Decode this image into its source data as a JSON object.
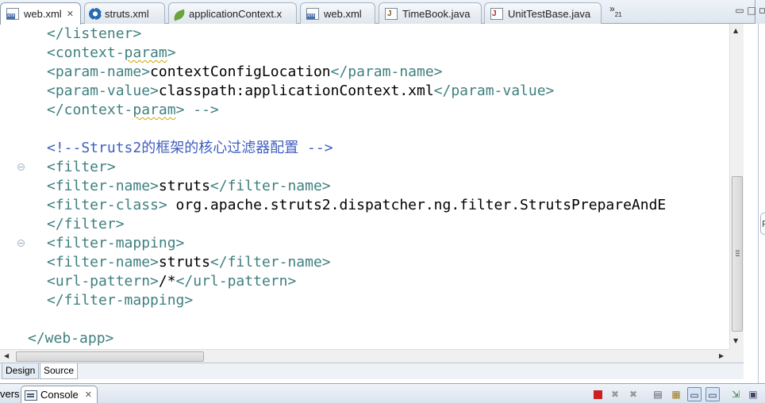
{
  "editor_tabs": [
    {
      "label": "web.xml",
      "icon": "xml-file-icon",
      "active": true,
      "closable": true
    },
    {
      "label": "struts.xml",
      "icon": "gear-icon",
      "active": false
    },
    {
      "label": "applicationContext.x",
      "icon": "spring-leaf-icon",
      "active": false
    },
    {
      "label": "web.xml",
      "icon": "xml-file-icon",
      "active": false
    },
    {
      "label": "TimeBook.java",
      "icon": "java-file-icon",
      "active": false
    },
    {
      "label": "UnitTestBase.java",
      "icon": "junit-file-icon",
      "active": false
    }
  ],
  "tab_overflow": {
    "chevron": "»",
    "count": "21"
  },
  "code_lines": [
    {
      "indent": 1,
      "parts": [
        {
          "t": "</listener>",
          "c": "tag"
        }
      ]
    },
    {
      "indent": 1,
      "parts": [
        {
          "t": "<context-",
          "c": "tag"
        },
        {
          "t": "param",
          "c": "tag",
          "w": true
        },
        {
          "t": ">",
          "c": "tag"
        }
      ]
    },
    {
      "indent": 1,
      "parts": [
        {
          "t": "<param-name>",
          "c": "tag"
        },
        {
          "t": "contextConfigLocation",
          "c": "txt"
        },
        {
          "t": "</param-name>",
          "c": "tag"
        }
      ]
    },
    {
      "indent": 1,
      "parts": [
        {
          "t": "<param-value>",
          "c": "tag"
        },
        {
          "t": "classpath:applicationContext.xml",
          "c": "txt"
        },
        {
          "t": "</param-value>",
          "c": "tag"
        }
      ]
    },
    {
      "indent": 1,
      "parts": [
        {
          "t": "</context-",
          "c": "tag"
        },
        {
          "t": "param",
          "c": "tag",
          "w": true
        },
        {
          "t": "> -->",
          "c": "tag"
        }
      ]
    },
    {
      "indent": 1,
      "parts": []
    },
    {
      "indent": 1,
      "parts": [
        {
          "t": "<!--Struts2的框架的核心过滤器配置 -->",
          "c": "cmt"
        }
      ]
    },
    {
      "indent": 1,
      "parts": [
        {
          "t": "<filter>",
          "c": "tag"
        }
      ],
      "fold": true
    },
    {
      "indent": 1,
      "parts": [
        {
          "t": "<filter-name>",
          "c": "tag"
        },
        {
          "t": "struts",
          "c": "txt"
        },
        {
          "t": "</filter-name>",
          "c": "tag"
        }
      ]
    },
    {
      "indent": 1,
      "parts": [
        {
          "t": "<filter-class>",
          "c": "tag"
        },
        {
          "t": " org.apache.struts2.dispatcher.ng.filter.StrutsPrepareAndE",
          "c": "txt"
        }
      ]
    },
    {
      "indent": 1,
      "parts": [
        {
          "t": "</filter>",
          "c": "tag"
        }
      ]
    },
    {
      "indent": 1,
      "parts": [
        {
          "t": "<filter-mapping>",
          "c": "tag"
        }
      ],
      "fold": true
    },
    {
      "indent": 1,
      "parts": [
        {
          "t": "<filter-name>",
          "c": "tag"
        },
        {
          "t": "struts",
          "c": "txt"
        },
        {
          "t": "</filter-name>",
          "c": "tag"
        }
      ]
    },
    {
      "indent": 1,
      "parts": [
        {
          "t": "<url-pattern>",
          "c": "tag"
        },
        {
          "t": "/*",
          "c": "txt"
        },
        {
          "t": "</url-pattern>",
          "c": "tag"
        }
      ]
    },
    {
      "indent": 1,
      "parts": [
        {
          "t": "</filter-mapping>",
          "c": "tag"
        }
      ]
    },
    {
      "indent": 0,
      "parts": []
    },
    {
      "indent": 0,
      "parts": [
        {
          "t": "</web-app>",
          "c": "tag"
        }
      ]
    }
  ],
  "mode_tabs": [
    {
      "label": "Design",
      "active": false
    },
    {
      "label": "Source",
      "active": true
    }
  ],
  "console_panel": {
    "truncated_tab_label": "vers",
    "console_tab_label": "Console",
    "toolbar_icons": [
      "terminate-icon",
      "remove-launch-icon",
      "remove-all-terminated-icon",
      "clear-console-icon",
      "scroll-lock-icon",
      "word-wrap-icon",
      "show-on-output-icon",
      "show-on-error-icon",
      "pin-console-icon",
      "new-console-icon"
    ]
  },
  "colors": {
    "tag": "#3f7f7f",
    "text": "#000000",
    "comment": "#3f5fbf",
    "terminate": "#cc1f1f"
  }
}
